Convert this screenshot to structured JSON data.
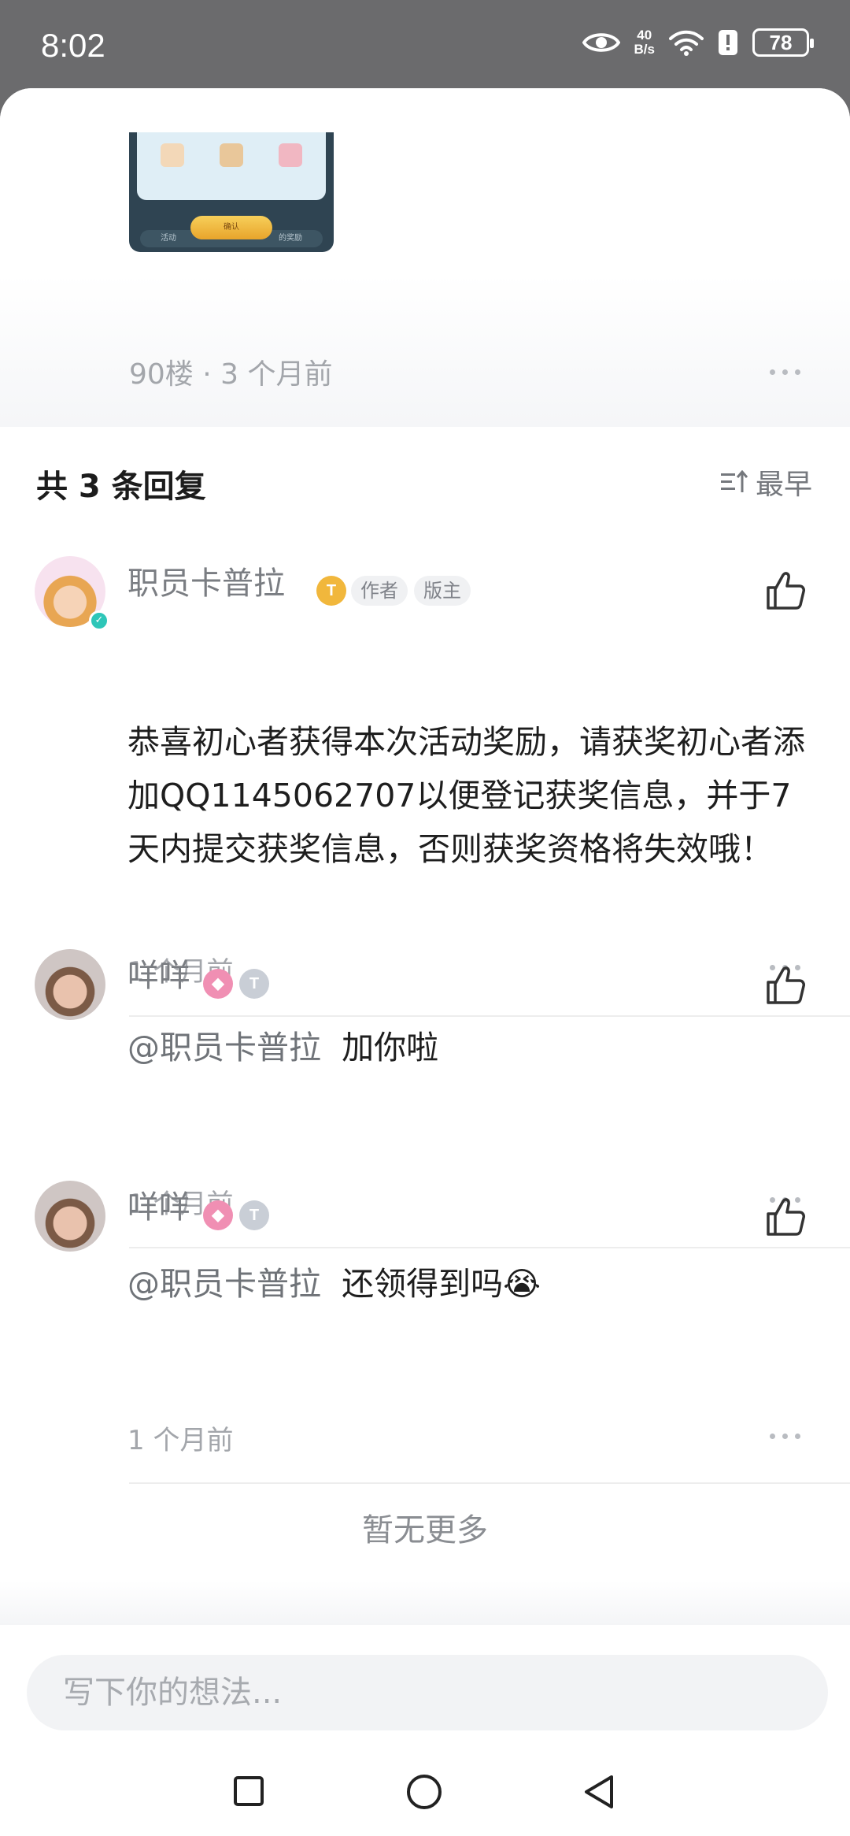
{
  "status_bar": {
    "time": "8:02",
    "net_speed_value": "40",
    "net_speed_unit": "B/s",
    "battery": "78",
    "icons": [
      "eye-icon",
      "wifi-icon",
      "alert-icon",
      "battery-icon"
    ]
  },
  "previous_post": {
    "thumbnail_button": "确认",
    "thumbnail_tab_left": "活动",
    "thumbnail_tab_right": "的奖励",
    "meta": "90楼 · 3 个月前"
  },
  "replies": {
    "header": "共 3 条回复",
    "sort_label": "最早",
    "items": [
      {
        "author": "职员卡普拉",
        "level_badge": "T",
        "tags": [
          "作者",
          "版主"
        ],
        "content": "恭喜初心者获得本次活动奖励，请获奖初心者添加QQ1145062707以便登记获奖信息，并于7天内提交获奖信息，否则获奖资格将失效哦！",
        "mention": "",
        "time": "1 个月前"
      },
      {
        "author": "咩咩",
        "level_badge": "T",
        "tags": [],
        "content": "加你啦",
        "mention": "@职员卡普拉",
        "time": "1 个月前"
      },
      {
        "author": "咩咩",
        "level_badge": "T",
        "tags": [],
        "content": "还领得到吗😭",
        "mention": "@职员卡普拉",
        "time": "1 个月前"
      }
    ],
    "no_more": "暂无更多"
  },
  "composer": {
    "placeholder": "写下你的想法..."
  },
  "colors": {
    "status_bar_bg": "#6b6b6d",
    "verified": "#2ec6b8",
    "gold_badge": "#f1b73c",
    "pink_badge": "#f08fb3",
    "silver_badge": "#c9ced6"
  }
}
